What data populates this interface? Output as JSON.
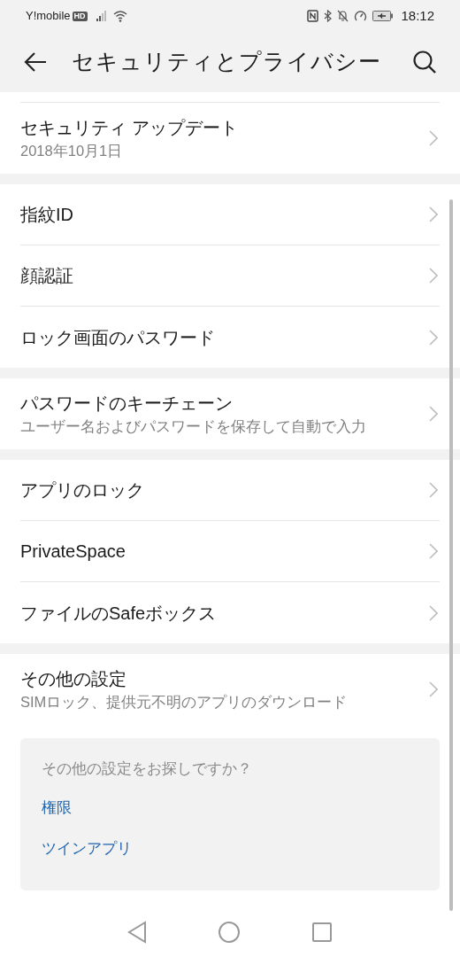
{
  "status_bar": {
    "carrier": "Y!mobile",
    "network_badge": "HD",
    "time": "18:12"
  },
  "header": {
    "title": "セキュリティとプライバシー"
  },
  "sections": [
    {
      "items": [
        {
          "title": "セキュリティ アップデート",
          "subtitle": "2018年10月1日"
        }
      ]
    },
    {
      "items": [
        {
          "title": "指紋ID"
        },
        {
          "title": "顔認証"
        },
        {
          "title": "ロック画面のパスワード"
        }
      ]
    },
    {
      "items": [
        {
          "title": "パスワードのキーチェーン",
          "subtitle": "ユーザー名およびパスワードを保存して自動で入力"
        }
      ]
    },
    {
      "items": [
        {
          "title": "アプリのロック"
        },
        {
          "title": "PrivateSpace"
        },
        {
          "title": "ファイルのSafeボックス"
        }
      ]
    },
    {
      "items": [
        {
          "title": "その他の設定",
          "subtitle": "SIMロック、提供元不明のアプリのダウンロード"
        }
      ]
    }
  ],
  "suggestions": {
    "title": "その他の設定をお探しですか？",
    "links": [
      "権限",
      "ツインアプリ"
    ]
  }
}
